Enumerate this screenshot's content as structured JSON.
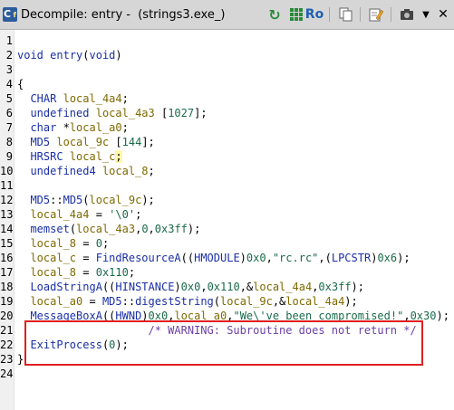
{
  "window": {
    "title": "Decompile: entry -  (strings3.exe_)",
    "ro_label": "Ro"
  },
  "toolbar_icons": [
    "refresh-icon",
    "grid-icon",
    "read-only-icon",
    "copy-icon",
    "edit-icon",
    "snapshot-icon",
    "menu-icon",
    "close-icon"
  ],
  "code": {
    "lines": [
      {
        "n": "1",
        "tokens": []
      },
      {
        "n": "2",
        "tokens": [
          [
            "kw",
            "void"
          ],
          [
            "pun",
            " "
          ],
          [
            "fn",
            "entry"
          ],
          [
            "pun",
            "("
          ],
          [
            "kw",
            "void"
          ],
          [
            "pun",
            ")"
          ]
        ]
      },
      {
        "n": "3",
        "tokens": []
      },
      {
        "n": "4",
        "tokens": [
          [
            "pun",
            "{"
          ]
        ]
      },
      {
        "n": "5",
        "tokens": [
          [
            "pun",
            "  "
          ],
          [
            "ty",
            "CHAR"
          ],
          [
            "pun",
            " "
          ],
          [
            "var",
            "local_4a4"
          ],
          [
            "pun",
            ";"
          ]
        ]
      },
      {
        "n": "6",
        "tokens": [
          [
            "pun",
            "  "
          ],
          [
            "ty",
            "undefined"
          ],
          [
            "pun",
            " "
          ],
          [
            "var",
            "local_4a3"
          ],
          [
            "pun",
            " ["
          ],
          [
            "num",
            "1027"
          ],
          [
            "pun",
            "];"
          ]
        ]
      },
      {
        "n": "7",
        "tokens": [
          [
            "pun",
            "  "
          ],
          [
            "ty",
            "char"
          ],
          [
            "pun",
            " *"
          ],
          [
            "var",
            "local_a0"
          ],
          [
            "pun",
            ";"
          ]
        ]
      },
      {
        "n": "8",
        "tokens": [
          [
            "pun",
            "  "
          ],
          [
            "ty",
            "MD5"
          ],
          [
            "pun",
            " "
          ],
          [
            "var",
            "local_9c"
          ],
          [
            "pun",
            " ["
          ],
          [
            "num",
            "144"
          ],
          [
            "pun",
            "];"
          ]
        ]
      },
      {
        "n": "9",
        "tokens": [
          [
            "pun",
            "  "
          ],
          [
            "ty",
            "HRSRC"
          ],
          [
            "pun",
            " "
          ],
          [
            "var",
            "local_c"
          ],
          [
            "cur",
            ";"
          ]
        ]
      },
      {
        "n": "10",
        "tokens": [
          [
            "pun",
            "  "
          ],
          [
            "ty",
            "undefined4"
          ],
          [
            "pun",
            " "
          ],
          [
            "var",
            "local_8"
          ],
          [
            "pun",
            ";"
          ]
        ]
      },
      {
        "n": "11",
        "tokens": []
      },
      {
        "n": "12",
        "tokens": [
          [
            "pun",
            "  "
          ],
          [
            "ty",
            "MD5"
          ],
          [
            "pun",
            "::"
          ],
          [
            "fn",
            "MD5"
          ],
          [
            "pun",
            "("
          ],
          [
            "var",
            "local_9c"
          ],
          [
            "pun",
            ");"
          ]
        ]
      },
      {
        "n": "13",
        "tokens": [
          [
            "pun",
            "  "
          ],
          [
            "var",
            "local_4a4"
          ],
          [
            "pun",
            " = "
          ],
          [
            "str",
            "'\\0'"
          ],
          [
            "pun",
            ";"
          ]
        ]
      },
      {
        "n": "14",
        "tokens": [
          [
            "pun",
            "  "
          ],
          [
            "fn",
            "memset"
          ],
          [
            "pun",
            "("
          ],
          [
            "var",
            "local_4a3"
          ],
          [
            "pun",
            ","
          ],
          [
            "num",
            "0"
          ],
          [
            "pun",
            ","
          ],
          [
            "num",
            "0x3ff"
          ],
          [
            "pun",
            ");"
          ]
        ]
      },
      {
        "n": "15",
        "tokens": [
          [
            "pun",
            "  "
          ],
          [
            "var",
            "local_8"
          ],
          [
            "pun",
            " = "
          ],
          [
            "num",
            "0"
          ],
          [
            "pun",
            ";"
          ]
        ]
      },
      {
        "n": "16",
        "tokens": [
          [
            "pun",
            "  "
          ],
          [
            "var",
            "local_c"
          ],
          [
            "pun",
            " = "
          ],
          [
            "fn",
            "FindResourceA"
          ],
          [
            "pun",
            "(("
          ],
          [
            "ty",
            "HMODULE"
          ],
          [
            "pun",
            ")"
          ],
          [
            "num",
            "0x0"
          ],
          [
            "pun",
            ","
          ],
          [
            "str",
            "\"rc.rc\""
          ],
          [
            "pun",
            ",("
          ],
          [
            "ty",
            "LPCSTR"
          ],
          [
            "pun",
            ")"
          ],
          [
            "num",
            "0x6"
          ],
          [
            "pun",
            ");"
          ]
        ]
      },
      {
        "n": "17",
        "tokens": [
          [
            "pun",
            "  "
          ],
          [
            "var",
            "local_8"
          ],
          [
            "pun",
            " = "
          ],
          [
            "num",
            "0x110"
          ],
          [
            "pun",
            ";"
          ]
        ]
      },
      {
        "n": "18",
        "tokens": [
          [
            "pun",
            "  "
          ],
          [
            "fn",
            "LoadStringA"
          ],
          [
            "pun",
            "(("
          ],
          [
            "ty",
            "HINSTANCE"
          ],
          [
            "pun",
            ")"
          ],
          [
            "num",
            "0x0"
          ],
          [
            "pun",
            ","
          ],
          [
            "num",
            "0x110"
          ],
          [
            "pun",
            ",&"
          ],
          [
            "var",
            "local_4a4"
          ],
          [
            "pun",
            ","
          ],
          [
            "num",
            "0x3ff"
          ],
          [
            "pun",
            ");"
          ]
        ]
      },
      {
        "n": "19",
        "tokens": [
          [
            "pun",
            "  "
          ],
          [
            "var",
            "local_a0"
          ],
          [
            "pun",
            " = "
          ],
          [
            "ty",
            "MD5"
          ],
          [
            "pun",
            "::"
          ],
          [
            "fn",
            "digestString"
          ],
          [
            "pun",
            "("
          ],
          [
            "var",
            "local_9c"
          ],
          [
            "pun",
            ",&"
          ],
          [
            "var",
            "local_4a4"
          ],
          [
            "pun",
            ");"
          ]
        ]
      },
      {
        "n": "20",
        "tokens": [
          [
            "pun",
            "  "
          ],
          [
            "fn",
            "MessageBoxA"
          ],
          [
            "pun",
            "(("
          ],
          [
            "ty",
            "HWND"
          ],
          [
            "pun",
            ")"
          ],
          [
            "num",
            "0x0"
          ],
          [
            "pun",
            ","
          ],
          [
            "var",
            "local_a0"
          ],
          [
            "pun",
            ","
          ],
          [
            "str",
            "\"We\\'ve been compromised!\""
          ],
          [
            "pun",
            ","
          ],
          [
            "num",
            "0x30"
          ],
          [
            "pun",
            ");"
          ]
        ]
      },
      {
        "n": "21",
        "tokens": [
          [
            "pun",
            "                    "
          ],
          [
            "cmt",
            "/* WARNING: Subroutine does not return */"
          ]
        ]
      },
      {
        "n": "22",
        "tokens": [
          [
            "pun",
            "  "
          ],
          [
            "fn",
            "ExitProcess"
          ],
          [
            "pun",
            "("
          ],
          [
            "num",
            "0"
          ],
          [
            "pun",
            ");"
          ]
        ]
      },
      {
        "n": "23",
        "tokens": [
          [
            "pun",
            "}"
          ]
        ]
      },
      {
        "n": "24",
        "tokens": []
      }
    ]
  }
}
